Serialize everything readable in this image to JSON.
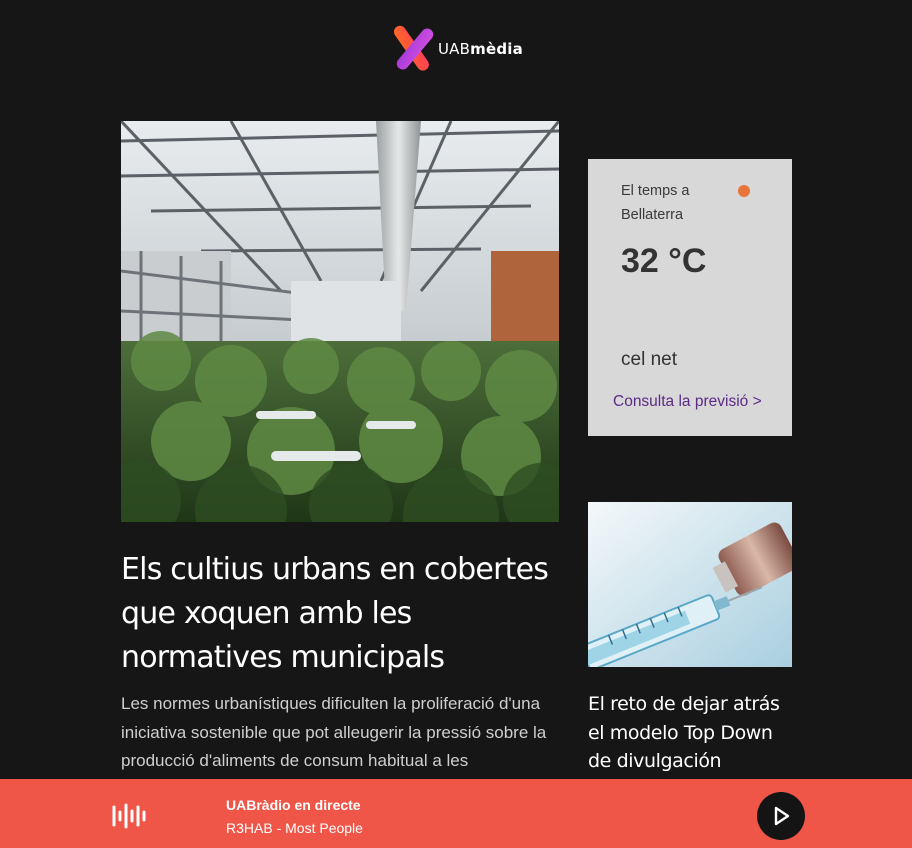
{
  "brand": {
    "name_regular": "UAB",
    "name_bold": "mèdia",
    "logo_colors": [
      "#ff5a2d",
      "#c13bd6"
    ]
  },
  "hero": {
    "image_icon": "greenhouse-tomato-plants-photo",
    "title": "Els cultius urbans en cobertes que xoquen amb les normatives municipals",
    "summary": "Les normes urbanístiques dificulten la proliferació d'una iniciativa sostenible que pot alleugerir la pressió sobre la producció d'aliments de consum habitual a les"
  },
  "weather": {
    "location": "El temps a Bellaterra",
    "temperature": "32 °C",
    "condition": "cel net",
    "link_label": "Consulta la previsió >",
    "indicator_color": "#e8743b"
  },
  "side_article": {
    "image_icon": "vaccine-syringe-vial-photo",
    "title": "El reto de dejar atrás el modelo Top Down de divulgación"
  },
  "player": {
    "station": "UABràdio en directe",
    "track": "R3HAB - Most People",
    "background": "#f05648",
    "wave_icon": "audio-wave-icon",
    "play_icon": "play-icon"
  }
}
